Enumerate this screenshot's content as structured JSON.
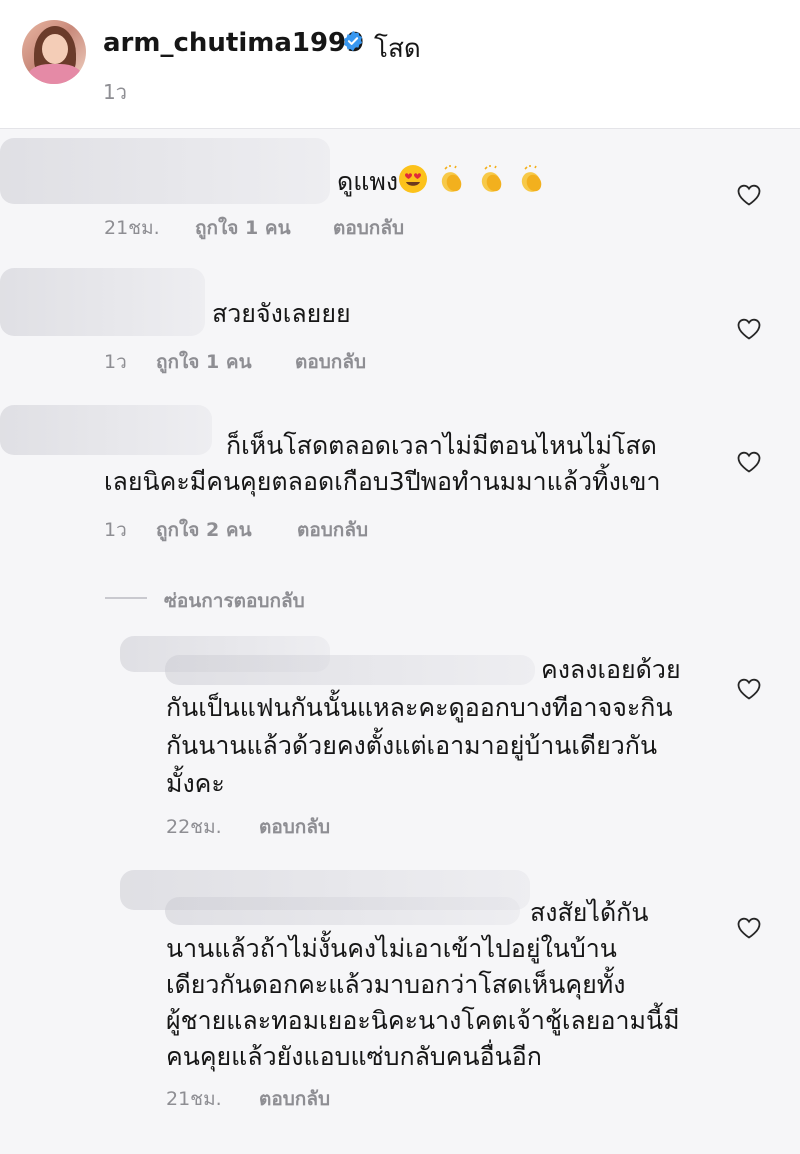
{
  "post": {
    "username": "arm_chutima1999",
    "caption": "โสด",
    "time": "1ว"
  },
  "comments": [
    {
      "text": "ดูแพง",
      "emojis": [
        "heart-eyes-face",
        "clapping-hands",
        "clapping-hands",
        "clapping-hands"
      ],
      "time": "21ชม.",
      "likes": "ถูกใจ 1 คน",
      "reply": "ตอบกลับ"
    },
    {
      "text": "สวยจังเลยยย",
      "time": "1ว",
      "likes": "ถูกใจ 1 คน",
      "reply": "ตอบกลับ"
    },
    {
      "lines": [
        "ก็เห็นโสดตลอดเวลาไม่มีตอนไหนไม่โสด",
        "เลยนิคะมีคนคุยตลอดเกือบ3ปีพอทำนมมาแล้วทิ้งเขา"
      ],
      "time": "1ว",
      "likes": "ถูกใจ 2 คน",
      "reply": "ตอบกลับ"
    }
  ],
  "hide_replies": "ซ่อนการตอบกลับ",
  "replies": [
    {
      "lines": [
        "คงลงเอยด้วย",
        "กันเป็นแฟนกันนั้นแหละคะดูออกบางทีอาจจะกิน",
        "กันนานแล้วด้วยคงตั้งแต่เอามาอยู่บ้านเดียวกัน",
        "มั้งคะ"
      ],
      "time": "22ชม.",
      "reply": "ตอบกลับ"
    },
    {
      "lines": [
        "สงสัยได้กัน",
        "นานแล้วถ้าไม่งั้นคงไม่เอาเข้าไปอยู่ในบ้าน",
        "เดียวกันดอกคะแล้วมาบอกว่าโสดเห็นคุยทั้ง",
        "ผู้ชายและทอมเยอะนิคะนางโคตเจ้าชู้เลยอามนี้มี",
        "คนคุยแล้วยังแอบแซ่บกลับคนอื่นอีก"
      ],
      "time": "21ชม.",
      "reply": "ตอบกลับ"
    }
  ],
  "colors": {
    "verified": "#3897f0",
    "muted": "#8e8e93",
    "heart_outline": "#262626"
  }
}
